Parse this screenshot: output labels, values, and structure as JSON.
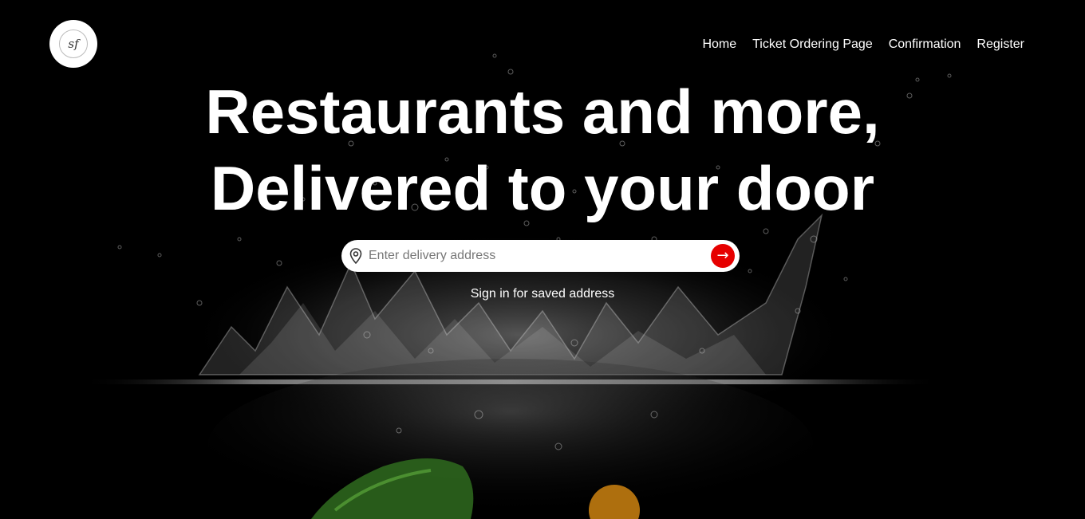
{
  "logo": {
    "text": "sf"
  },
  "nav": {
    "items": [
      {
        "label": "Home"
      },
      {
        "label": "Ticket Ordering Page"
      },
      {
        "label": "Confirmation"
      },
      {
        "label": "Register"
      }
    ]
  },
  "hero": {
    "headline_line1": "Restaurants and more,",
    "headline_line2": "Delivered to your door",
    "background_image": "water-splash-vegetables"
  },
  "search": {
    "placeholder": "Enter delivery address",
    "value": "",
    "icon": "location-pin-icon",
    "button_icon": "arrow-right-icon",
    "button_label": "→"
  },
  "signin": {
    "text": "Sign in for saved address"
  },
  "colors": {
    "background": "#000000",
    "accent": "#e60000",
    "text": "#ffffff"
  }
}
